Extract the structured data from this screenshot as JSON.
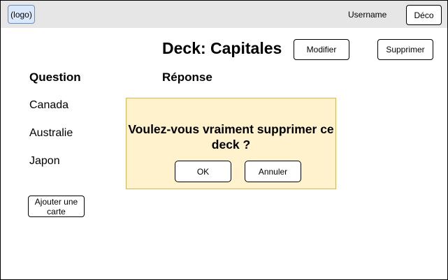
{
  "header": {
    "logo_label": "(logo)",
    "username": "Username",
    "logout_label": "Déco"
  },
  "deck": {
    "title": "Deck: Capitales",
    "modify_label": "Modifier",
    "delete_label": "Supprimer"
  },
  "table": {
    "question_header": "Question",
    "answer_header": "Réponse",
    "questions": [
      "Canada",
      "Australie",
      "Japon"
    ]
  },
  "add_card_label": "Ajouter une carte",
  "dialog": {
    "message": "Voulez-vous vraiment supprimer ce deck ?",
    "ok_label": "OK",
    "cancel_label": "Annuler"
  },
  "colors": {
    "topbar": "#e6e6e6",
    "logo_fill": "#dae8fc",
    "logo_border": "#6c8ebf",
    "dialog_fill": "#fff2cc",
    "dialog_border": "#d6b656"
  }
}
